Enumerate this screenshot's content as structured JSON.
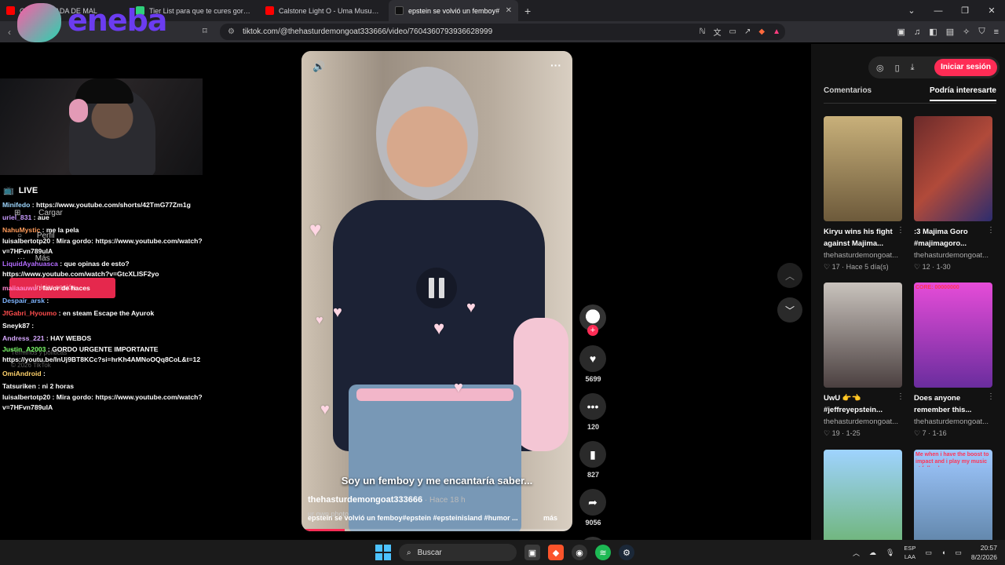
{
  "browser": {
    "tabs": [
      {
        "title": "O TIENE NADA DE MAL",
        "color": "#ff0000"
      },
      {
        "title": "Tier List para que te cures gordo - Im",
        "color": "#2fd07b"
      },
      {
        "title": "Calstone Light O - Uma Musume Pre",
        "color": "#ff0000"
      },
      {
        "title": "epstein se volvió un femboy#",
        "color": "#111111"
      }
    ],
    "new_tab": "+",
    "url": "tiktok.com/@thehasturdemongoat333666/video/7604360793936628999"
  },
  "overlay": {
    "logo_text": "eneba"
  },
  "tiktok_nav": {
    "live": "LIVE",
    "upload": "Cargar",
    "profile": "Perfil",
    "more": "Más",
    "login": "Iniciar sesión",
    "terms": "Términos y políticas",
    "copyright": "© 2026 TikTok"
  },
  "chat": [
    {
      "user": "Minifedo",
      "color": "#9fd7ff",
      "text": "https://www.youtube.com/shorts/42TmG77Zm1g"
    },
    {
      "user": "uriel_831",
      "color": "#c89bff",
      "text": "aue"
    },
    {
      "user": "NahuMystic",
      "color": "#ff9b5a",
      "text": "me la pela"
    },
    {
      "user": "luisalbertotp20",
      "color": "#ffffff",
      "text": "Mira gordo: https://www.youtube.com/watch?v=7HFvn789uIA",
      "wrap": true
    },
    {
      "user": "LiquidAyahuasca",
      "color": "#b46cff",
      "text": "que opinas de esto? https://www.youtube.com/watch?v=GtcXLISF2yo",
      "wrap": true
    },
    {
      "user": "maiiaauwu",
      "color": "#ff8ad1",
      "text": "favor de haces"
    },
    {
      "user": "Despair_arsk",
      "color": "#7fb5ff",
      "text": ""
    },
    {
      "user": "JfGabri_Hyoumo",
      "color": "#ff4d4d",
      "text": "en steam Escape the Ayurok"
    },
    {
      "user": "Sneyk87",
      "color": "#ffffff",
      "text": ""
    },
    {
      "user": "Andress_221",
      "color": "#d7a8ff",
      "text": "HAY WEBOS"
    },
    {
      "user": "Justin_A2003",
      "color": "#7dff6b",
      "text": "GORDO URGENTE IMPORTANTE https://youtu.be/InUj9BT8KCc?si=hrKh4AMNoOQq8CoL&t=12",
      "wrap": true
    },
    {
      "user": "OmiAndroid",
      "color": "#ffd26b",
      "text": ""
    },
    {
      "user": "Tatsuriken",
      "color": "#ffffff",
      "text": "ni 2 horas"
    },
    {
      "user": "luisalbertotp20",
      "color": "#ffffff",
      "text": "Mira gordo: https://www.youtube.com/watch?v=7HFvn789uIA",
      "wrap": true
    }
  ],
  "video": {
    "caption": "Soy un femboy y me encantaría saber...",
    "author": "thehasturdemongoat333666",
    "when": "Hace 18 h",
    "description": "epstein se volvió un femboy#epstein #epsteinisland #humor ...",
    "more": "más",
    "sound": "ur own photo",
    "progress": 0.16
  },
  "actions": {
    "likes": "5699",
    "comments": "120",
    "saves": "827",
    "shares": "9056"
  },
  "right_panel": {
    "login": "Iniciar sesión",
    "tabs": [
      "Comentarios",
      "Podría interesarte"
    ],
    "cards": [
      {
        "title": "Kiryu wins his fight against Majima...",
        "author": "thehasturdemongoat...",
        "likes": "17",
        "time": "Hace 5 día(s)",
        "bg": "linear-gradient(180deg,#c8b07a,#6d5a3b)"
      },
      {
        "title": ":3 Majima Goro #majimagoro...",
        "author": "thehasturdemongoat...",
        "likes": "12",
        "time": "1-30",
        "bg": "linear-gradient(135deg,#6b2a2a,#b14a3a,#2c2c6e)"
      },
      {
        "title": "UwU 👉👈 #jeffreyepstein...",
        "author": "thehasturdemongoat...",
        "likes": "19",
        "time": "1-25",
        "bg": "linear-gradient(180deg,#c9c3bd,#4b4040)"
      },
      {
        "title": "Does anyone remember this...",
        "author": "thehasturdemongoat...",
        "likes": "7",
        "time": "1-16",
        "bg": "linear-gradient(180deg,#e64cd8,#6a2d9e)",
        "overlay": "CORE: 00000000"
      },
      {
        "title": "",
        "author": "",
        "likes": "",
        "time": "",
        "bg": "linear-gradient(180deg,#9fd3ff,#6ab26b)"
      },
      {
        "title": "",
        "author": "",
        "likes": "",
        "time": "",
        "bg": "linear-gradient(180deg,#9fc8ff,#5a7ea0)",
        "overlay": "Me when i have the boost to impact and i play my music at full volume"
      }
    ]
  },
  "taskbar": {
    "search": "Buscar",
    "lang_top": "ESP",
    "lang_bottom": "LAA",
    "time": "20:57",
    "date": "8/2/2026"
  }
}
